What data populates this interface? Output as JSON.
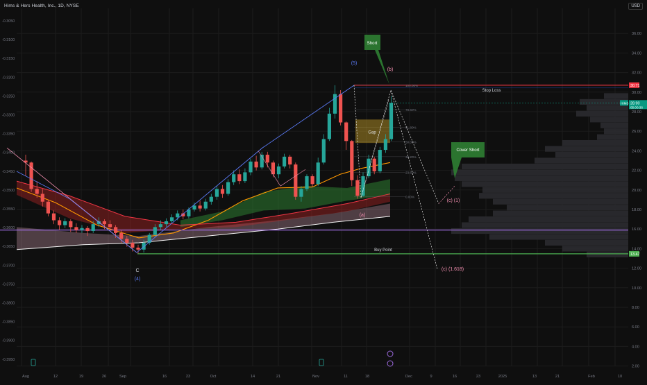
{
  "header": {
    "title": "Hims & Hers Health, Inc., 1D, NYSE",
    "currency": "USD"
  },
  "colors": {
    "background": "#0f0f0f",
    "up": "#26a69a",
    "down": "#ef5350",
    "stop_loss": "#f23645",
    "buy_point": "#4caf50",
    "mid_line": "#9c6ade",
    "fib_line": "#2962ff",
    "label_green": "#2e7d32"
  },
  "chart_data": {
    "type": "candlestick",
    "left_axis": {
      "ticks": [
        "-0.3050",
        "-0.3100",
        "-0.3150",
        "-0.3200",
        "-0.3250",
        "-0.3300",
        "-0.3350",
        "-0.3400",
        "-0.3450",
        "-0.3500",
        "-0.3550",
        "-0.3600",
        "-0.3650",
        "-0.3700",
        "-0.3750",
        "-0.3800",
        "-0.3850",
        "-0.3900",
        "-0.3950",
        "-0.4000"
      ]
    },
    "right_axis": {
      "ylim": [
        2,
        38
      ],
      "ticks": [
        "36.00",
        "34.00",
        "32.00",
        "30.00",
        "28.00",
        "26.00",
        "24.00",
        "22.00",
        "20.00",
        "18.00",
        "16.00",
        "14.00",
        "12.00",
        "10.00",
        "8.00",
        "6.00",
        "4.00",
        "2.00"
      ],
      "price_tags": [
        {
          "text": "30.71",
          "value": 30.71,
          "color": "#f23645"
        },
        {
          "text": "HIMS",
          "value": 28.9,
          "color": "#089981"
        },
        {
          "text": "28.90",
          "value": 28.9,
          "color": "#089981"
        },
        {
          "text": "05:00:36",
          "value": 28.45,
          "color": "#089981"
        },
        {
          "text": "13.47",
          "value": 13.47,
          "color": "#4caf50"
        }
      ]
    },
    "x_axis": {
      "ticks": [
        "Aug",
        "12",
        "19",
        "26",
        "Sep",
        "16",
        "23",
        "Oct",
        "14",
        "21",
        "Nov",
        "11",
        "18",
        "Dec",
        "9",
        "16",
        "23",
        "2025",
        "13",
        "21",
        "Feb",
        "10"
      ]
    },
    "candles": [
      [
        23,
        22.8,
        23.6,
        21.4
      ],
      [
        22.8,
        20.1,
        22.9,
        19.8
      ],
      [
        20.1,
        19.6,
        20.9,
        19.2
      ],
      [
        19.6,
        18.8,
        20.1,
        18.3
      ],
      [
        18.8,
        17.6,
        19.0,
        17.3
      ],
      [
        17.6,
        16.9,
        17.9,
        16.5
      ],
      [
        16.9,
        16.4,
        17.2,
        15.9
      ],
      [
        16.4,
        16.8,
        17.1,
        16.1
      ],
      [
        16.8,
        16.2,
        17.0,
        15.7
      ],
      [
        16.2,
        15.9,
        16.6,
        15.6
      ],
      [
        15.9,
        16.1,
        16.4,
        15.6
      ],
      [
        16.1,
        15.8,
        16.3,
        15.3
      ],
      [
        15.8,
        16.5,
        16.8,
        15.6
      ],
      [
        16.5,
        16.8,
        17.2,
        16.2
      ],
      [
        16.8,
        16.5,
        17.0,
        16.0
      ],
      [
        16.5,
        16.2,
        16.9,
        15.8
      ],
      [
        16.2,
        15.6,
        16.4,
        15.1
      ],
      [
        15.6,
        15.0,
        15.9,
        14.6
      ],
      [
        15.0,
        14.6,
        15.3,
        14.2
      ],
      [
        14.6,
        14.1,
        14.9,
        13.7
      ],
      [
        14.1,
        13.9,
        14.4,
        13.5
      ],
      [
        13.9,
        14.6,
        14.9,
        13.6
      ],
      [
        14.6,
        15.4,
        15.6,
        14.4
      ],
      [
        15.4,
        16.2,
        16.5,
        15.2
      ],
      [
        16.2,
        16.5,
        16.9,
        15.9
      ],
      [
        16.5,
        16.8,
        17.1,
        16.2
      ],
      [
        16.8,
        17.2,
        17.5,
        16.6
      ],
      [
        17.2,
        17.6,
        17.9,
        16.9
      ],
      [
        17.6,
        17.3,
        18.0,
        17.0
      ],
      [
        17.3,
        18.0,
        18.2,
        17.1
      ],
      [
        18.0,
        18.4,
        18.7,
        17.8
      ],
      [
        18.4,
        18.1,
        18.9,
        17.8
      ],
      [
        18.1,
        18.8,
        19.1,
        17.9
      ],
      [
        18.8,
        19.3,
        19.6,
        18.5
      ],
      [
        19.3,
        20.1,
        20.4,
        19.0
      ],
      [
        20.1,
        19.6,
        20.5,
        19.2
      ],
      [
        19.6,
        20.8,
        21.1,
        19.4
      ],
      [
        20.8,
        21.6,
        22.0,
        20.5
      ],
      [
        21.6,
        20.9,
        22.1,
        20.6
      ],
      [
        20.9,
        21.8,
        22.2,
        20.7
      ],
      [
        21.8,
        22.9,
        23.2,
        21.5
      ],
      [
        22.9,
        22.3,
        23.5,
        22.0
      ],
      [
        22.3,
        23.6,
        23.9,
        22.1
      ],
      [
        23.6,
        22.8,
        23.9,
        22.3
      ],
      [
        22.8,
        21.6,
        23.0,
        21.3
      ],
      [
        21.6,
        22.4,
        22.7,
        21.2
      ],
      [
        22.4,
        23.4,
        23.7,
        22.2
      ],
      [
        23.4,
        22.6,
        23.6,
        22.2
      ],
      [
        22.6,
        19.3,
        22.8,
        19.0
      ],
      [
        19.3,
        20.1,
        20.4,
        18.8
      ],
      [
        20.1,
        21.4,
        21.6,
        19.9
      ],
      [
        21.4,
        20.6,
        21.6,
        20.3
      ],
      [
        20.6,
        22.8,
        23.3,
        20.4
      ],
      [
        22.8,
        25.2,
        25.7,
        22.6
      ],
      [
        25.2,
        27.8,
        28.4,
        25.0
      ],
      [
        27.8,
        29.8,
        30.7,
        27.3
      ],
      [
        29.8,
        26.9,
        30.2,
        26.6
      ],
      [
        26.9,
        25.0,
        27.0,
        24.1
      ],
      [
        25.0,
        21.0,
        25.1,
        20.4
      ],
      [
        21.0,
        19.4,
        21.5,
        19.1
      ],
      [
        19.4,
        21.4,
        21.8,
        19.3
      ],
      [
        21.4,
        23.2,
        23.6,
        21.2
      ],
      [
        23.2,
        21.9,
        23.4,
        21.6
      ],
      [
        21.9,
        24.1,
        24.4,
        21.7
      ],
      [
        24.1,
        25.2,
        25.7,
        23.8
      ],
      [
        25.2,
        28.9,
        29.6,
        25.0
      ]
    ],
    "bands": [
      {
        "name": "EMA 20",
        "color": "#ff9800"
      },
      {
        "name": "EMA 50",
        "color": "#4caf50"
      },
      {
        "name": "EMA 100",
        "color": "#f23645"
      },
      {
        "name": "EMA 200",
        "color": "#f8bbd0"
      }
    ],
    "levels": {
      "stop_loss": 30.71,
      "buy_point": 13.47,
      "mid_line": 15.9,
      "current": 28.9
    },
    "fib_labels": [
      "100.00%",
      "78.60%",
      "61.80%",
      "50.00%",
      "38.20%",
      "23.60%",
      "0.00%"
    ],
    "fib_levels": [
      30.71,
      28.2,
      26.4,
      24.9,
      23.4,
      21.8,
      19.3
    ],
    "annotations": {
      "stop_loss": "Stop Loss",
      "buy_point": "Buy Point",
      "gap": "Gap",
      "short": "Short",
      "cover_short": "Cover Short",
      "wave_5": "(5)",
      "wave_b": "(b)",
      "wave_a": "(a)",
      "wave_c1": "(c) (1)",
      "wave_c1618": "(c) (1.618)",
      "wave_C": "C",
      "wave_4": "(4)"
    }
  }
}
